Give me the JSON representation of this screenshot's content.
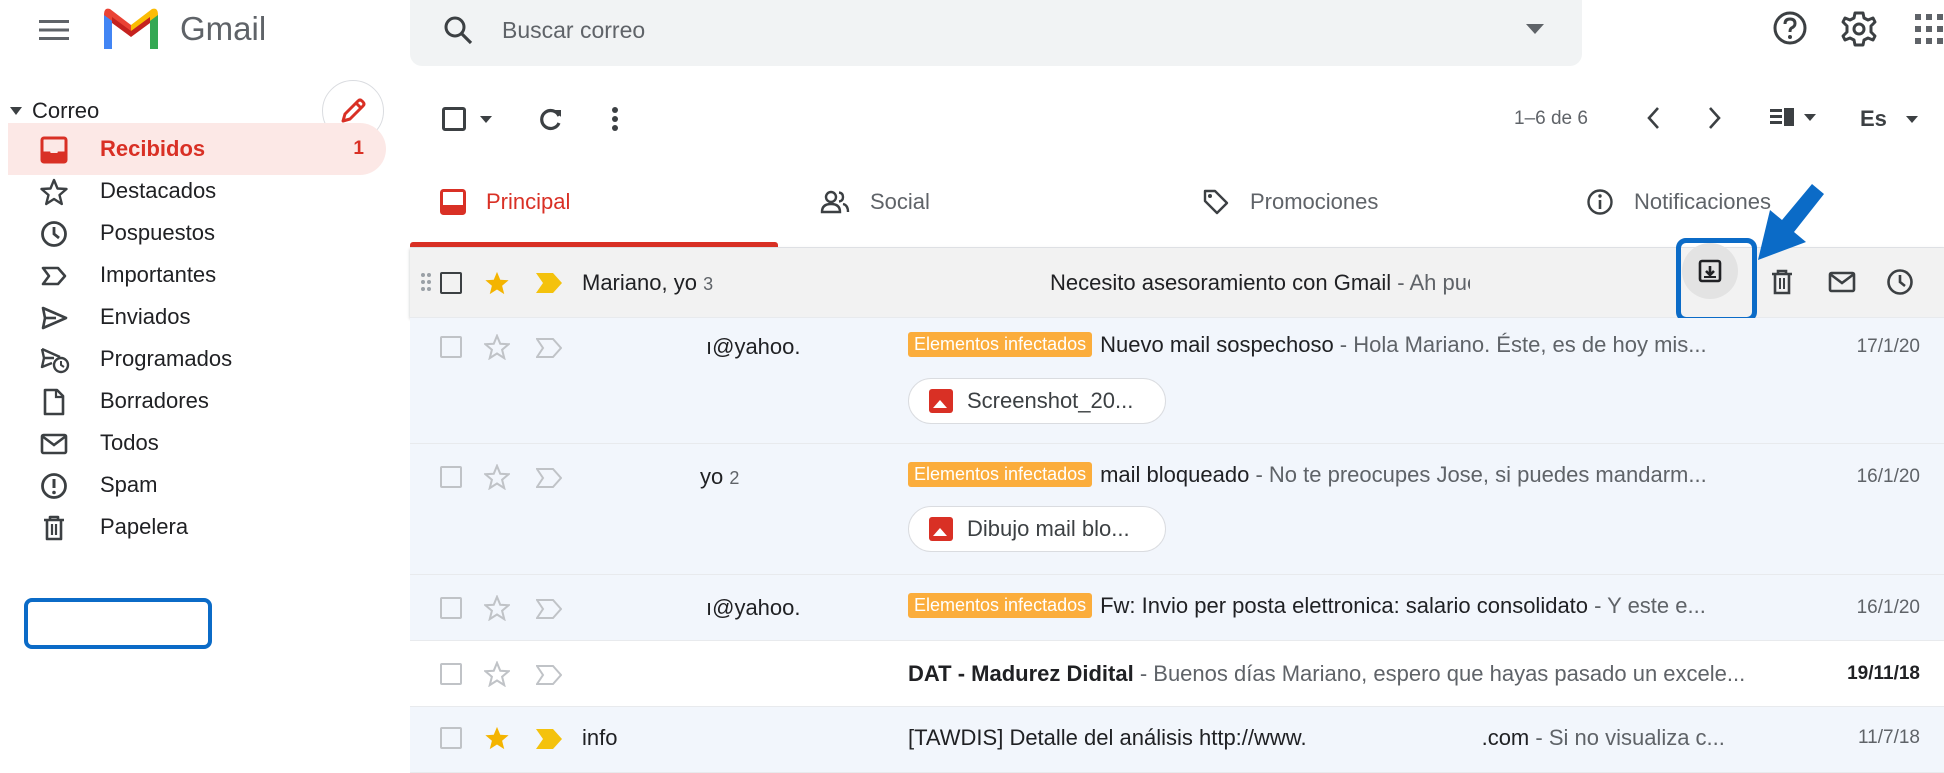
{
  "app": {
    "name": "Gmail"
  },
  "search": {
    "placeholder": "Buscar correo"
  },
  "sidebar": {
    "section": "Correo",
    "items": [
      {
        "label": "Recibidos",
        "count": "1",
        "icon": "inbox-icon"
      },
      {
        "label": "Destacados",
        "icon": "star-icon"
      },
      {
        "label": "Pospuestos",
        "icon": "clock-icon"
      },
      {
        "label": "Importantes",
        "icon": "label-important-icon"
      },
      {
        "label": "Enviados",
        "icon": "send-icon"
      },
      {
        "label": "Programados",
        "icon": "scheduled-send-icon"
      },
      {
        "label": "Borradores",
        "icon": "draft-icon"
      },
      {
        "label": "Todos",
        "icon": "mail-icon"
      },
      {
        "label": "Spam",
        "icon": "spam-icon"
      },
      {
        "label": "Papelera",
        "icon": "trash-icon"
      }
    ]
  },
  "toolbar": {
    "pagination": "1–6 de 6",
    "language": "Es"
  },
  "tabs": [
    {
      "label": "Principal"
    },
    {
      "label": "Social"
    },
    {
      "label": "Promociones"
    },
    {
      "label": "Notificaciones"
    }
  ],
  "emails": [
    {
      "sender": "Mariano, yo",
      "count": "3",
      "subject": "Necesito asesoramiento con Gmail",
      "snippet": " - Ah pues estupendo, ...",
      "starred": true,
      "important": true
    },
    {
      "sender": "ı@yahoo.",
      "label": "Elementos infectados",
      "subject": "Nuevo mail sospechoso",
      "snippet": " - Hola Mariano. Éste, es de hoy mis...",
      "date": "17/1/20",
      "attachment": "Screenshot_20..."
    },
    {
      "sender": "yo",
      "count": "2",
      "label": "Elementos infectados",
      "subject": "mail bloqueado",
      "snippet": " - No te preocupes Jose, si puedes mandarm...",
      "date": "16/1/20",
      "attachment": "Dibujo mail blo..."
    },
    {
      "sender": "ı@yahoo.",
      "label": "Elementos infectados",
      "subject": "Fw: Invio per posta elettronica: salario consolidato",
      "snippet": " - Y este e...",
      "date": "16/1/20"
    },
    {
      "sender": "",
      "subject": "DAT - Madurez Didital",
      "snippet": " - Buenos días Mariano, espero que hayas pasado un excele...",
      "date": "19/11/18",
      "unread": true
    },
    {
      "sender": "info",
      "subject": "[TAWDIS] Detalle del análisis http://www.",
      "subject_tail": ".com",
      "snippet": " - Si no visualiza c...",
      "date": "11/7/18",
      "starred": true,
      "important": true
    }
  ],
  "colors": {
    "accent": "#d93025",
    "highlight": "#0b6bc7",
    "label": "#fbad3c"
  }
}
